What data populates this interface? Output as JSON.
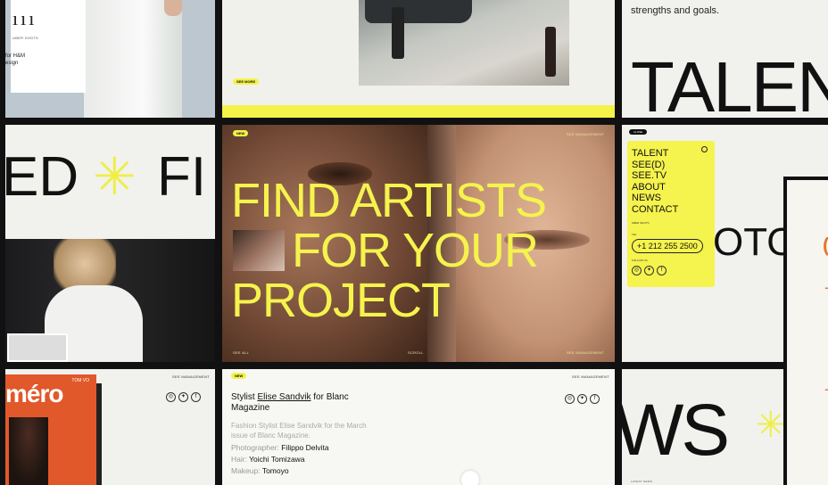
{
  "tile_top_left": {
    "caption_line1": "for H&M",
    "caption_line2": "esign",
    "credit": "UBER SHOTS"
  },
  "tile_top_mid": {
    "see_more": "SEE MORE"
  },
  "tile_top_right": {
    "text": "strengths and goals.",
    "big": "TALEN"
  },
  "tile_mid_left": {
    "big_left": "ED",
    "big_right": "FI",
    "star": "✳"
  },
  "hero": {
    "badge": "NEW",
    "headline_1": "FIND ARTISTS",
    "headline_2": "FOR YOUR",
    "headline_3": "PROJECT",
    "top_right": "SEE MANAGEMENT",
    "bottom_left": "SEE ALL",
    "bottom_mid": "SCROLL",
    "bottom_right": "SEE MANAGEMENT"
  },
  "menu": {
    "tag": "CLOSE",
    "items": [
      "TALENT",
      "SEE(D)",
      "SEE.TV",
      "ABOUT",
      "NEWS",
      "CONTACT"
    ],
    "small1": "UBER SHOTS",
    "tel_label": "TEL",
    "phone": "+1 212 255 2500",
    "follow": "FOLLOW US",
    "big_right": "OTO"
  },
  "tile_bot_left": {
    "header": "SEE MANAGEMENT",
    "magazine": "méro",
    "mag_tag": "TOM VO"
  },
  "article": {
    "badge": "NEW",
    "header": "SEE MANAGEMENT",
    "title_pre": "Stylist ",
    "title_link": "Elise Sandvik",
    "title_post": " for Blanc Magazine",
    "desc": "Fashion Stylist Elise Sandvik for the March issue of Blanc Magazine.",
    "credits": [
      {
        "label": "Photographer:",
        "name": "Filippo Delvita"
      },
      {
        "label": "Hair:",
        "name": "Yoichi Tomizawa"
      },
      {
        "label": "Makeup:",
        "name": "Tomoyo"
      }
    ]
  },
  "tile_bot_right": {
    "big": "WS",
    "small": "LATEST NEWS"
  },
  "overlay": {
    "glyph1": "(",
    "glyph2": "-"
  }
}
